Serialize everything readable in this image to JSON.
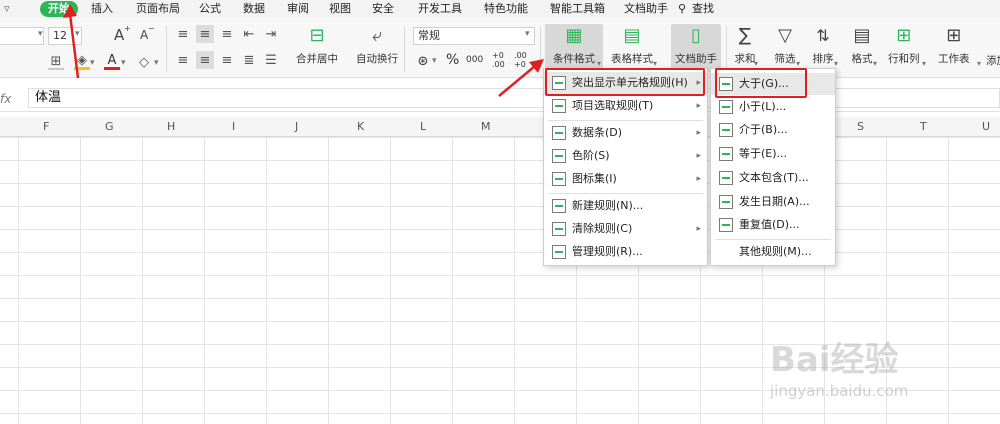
{
  "menubar": {
    "items": [
      "开始",
      "插入",
      "页面布局",
      "公式",
      "数据",
      "审阅",
      "视图",
      "安全",
      "开发工具",
      "特色功能",
      "智能工具箱",
      "文档助手",
      "查找"
    ]
  },
  "ribbon": {
    "font_size": "12",
    "number_format": "常规",
    "merge_label": "合并居中",
    "wrap_label": "自动换行",
    "cond_format_label": "条件格式",
    "table_style_label": "表格样式",
    "doc_assist_label": "文档助手",
    "sum_label": "求和",
    "filter_label": "筛选",
    "sort_label": "排序",
    "format_label": "格式",
    "rowcol_label": "行和列",
    "sheet_label": "工作表",
    "more_label": "添加",
    "percent": "%",
    "thousands": "000",
    "inc_decimal": "+0 .00",
    "dec_decimal": ".00 +0",
    "font_grow": "A",
    "font_shrink": "A"
  },
  "formula_bar": {
    "fx": "fx",
    "value": "体温"
  },
  "columns": [
    "F",
    "G",
    "H",
    "I",
    "J",
    "K",
    "L",
    "M",
    "S",
    "T",
    "U"
  ],
  "cond_menu": {
    "items": [
      "突出显示单元格规则(H)",
      "项目选取规则(T)",
      "数据条(D)",
      "色阶(S)",
      "图标集(I)",
      "新建规则(N)...",
      "清除规则(C)",
      "管理规则(R)..."
    ]
  },
  "highlight_menu": {
    "items": [
      "大于(G)...",
      "小于(L)...",
      "介于(B)...",
      "等于(E)...",
      "文本包含(T)...",
      "发生日期(A)...",
      "重复值(D)...",
      "其他规则(M)..."
    ]
  },
  "watermark": {
    "brand": "Bai经验",
    "url": "jingyan.baidu.com"
  },
  "colors": {
    "accent": "#2db558",
    "annotation": "#e02020"
  }
}
